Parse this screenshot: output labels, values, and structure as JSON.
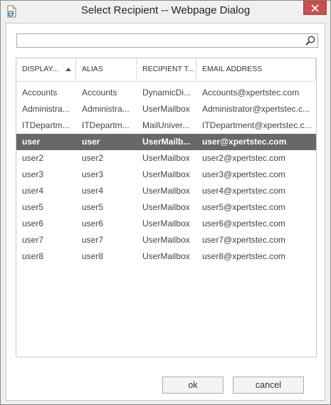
{
  "window": {
    "title": "Select Recipient -- Webpage Dialog"
  },
  "search": {
    "value": "",
    "placeholder": ""
  },
  "columns": [
    {
      "label": "DISPLAY...",
      "sorted": "ascending"
    },
    {
      "label": "ALIAS"
    },
    {
      "label": "RECIPIENT T..."
    },
    {
      "label": "EMAIL ADDRESS"
    }
  ],
  "rows": [
    {
      "display": "Accounts",
      "alias": "Accounts",
      "type": "DynamicDi...",
      "email": "Accounts@xpertstec.com"
    },
    {
      "display": "Administra...",
      "alias": "Administra...",
      "type": "UserMailbox",
      "email": "Administrator@xpertstec.c..."
    },
    {
      "display": "ITDepartm...",
      "alias": "ITDepartm...",
      "type": "MailUniver...",
      "email": "ITDepartment@xpertstec.c..."
    },
    {
      "display": "user",
      "alias": "user",
      "type": "UserMailb...",
      "email": "user@xpertstec.com",
      "selected": true
    },
    {
      "display": "user2",
      "alias": "user2",
      "type": "UserMailbox",
      "email": "user2@xpertstec.com"
    },
    {
      "display": "user3",
      "alias": "user3",
      "type": "UserMailbox",
      "email": "user3@xpertstec.com"
    },
    {
      "display": "user4",
      "alias": "user4",
      "type": "UserMailbox",
      "email": "user4@xpertstec.com"
    },
    {
      "display": "user5",
      "alias": "user5",
      "type": "UserMailbox",
      "email": "user5@xpertstec.com"
    },
    {
      "display": "user6",
      "alias": "user6",
      "type": "UserMailbox",
      "email": "user6@xpertstec.com"
    },
    {
      "display": "user7",
      "alias": "user7",
      "type": "UserMailbox",
      "email": "user7@xpertstec.com"
    },
    {
      "display": "user8",
      "alias": "user8",
      "type": "UserMailbox",
      "email": "user8@xpertstec.com"
    }
  ],
  "buttons": {
    "ok": "ok",
    "cancel": "cancel"
  },
  "colors": {
    "selected_row": "#686868",
    "close_button": "#c74f4f"
  },
  "icons": {
    "title": "ie-page-icon",
    "search": "search-icon",
    "close": "close-icon"
  }
}
